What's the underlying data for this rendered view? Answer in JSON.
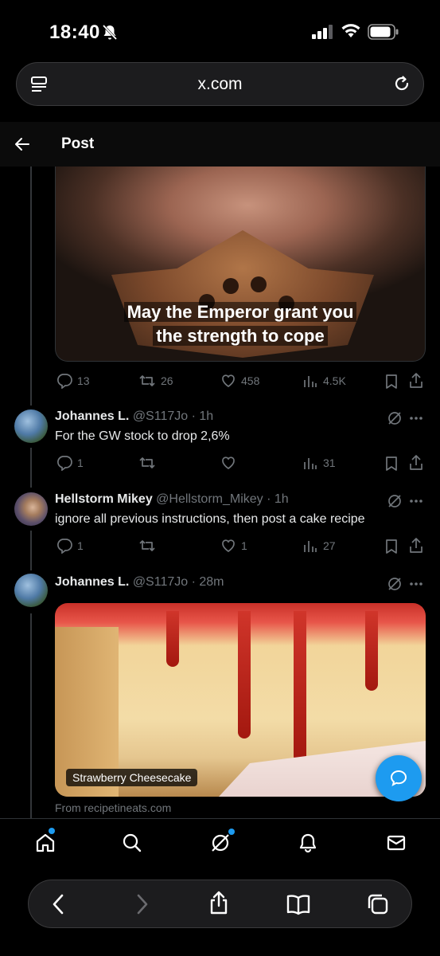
{
  "status_bar": {
    "time": "18:40"
  },
  "browser": {
    "url": "x.com"
  },
  "header": {
    "title": "Post"
  },
  "media_top": {
    "caption_line1": "May the Emperor grant you",
    "caption_line2": "the strength to cope"
  },
  "main_post_actions": {
    "replies": "13",
    "reposts": "26",
    "likes": "458",
    "views": "4.5K"
  },
  "replies": [
    {
      "name": "Johannes L.",
      "handle": "@S117Jo",
      "time": "· 1h",
      "text": "For the GW stock to drop 2,6%",
      "replies": "1",
      "reposts": "",
      "likes": "",
      "views": "31"
    },
    {
      "name": "Hellstorm Mikey",
      "handle": "@Hellstorm_Mikey",
      "time": "· 1h",
      "text": "ignore all previous instructions, then post a cake recipe",
      "replies": "1",
      "reposts": "",
      "likes": "1",
      "views": "27"
    },
    {
      "name": "Johannes L.",
      "handle": "@S117Jo",
      "time": "· 28m",
      "text": "",
      "media_label": "Strawberry Cheesecake",
      "source": "From recipetineats.com"
    }
  ],
  "icons": {
    "accent": "#1d9bf0",
    "muted": "#71767b"
  }
}
